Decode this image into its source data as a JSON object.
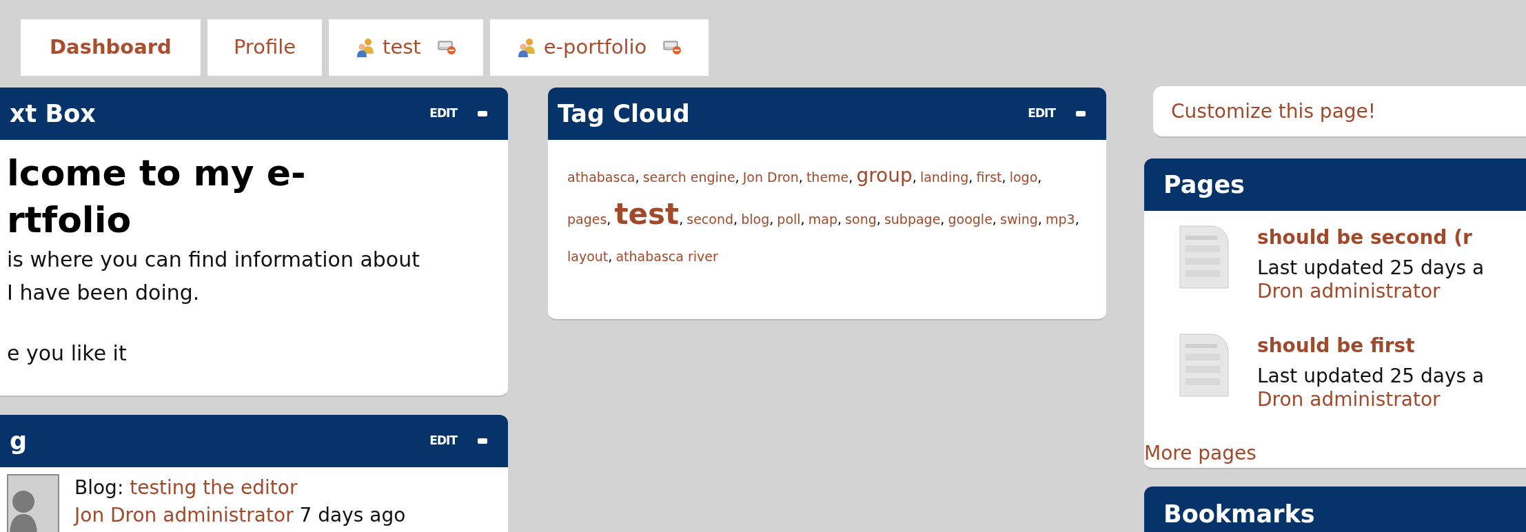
{
  "tabs": [
    {
      "label": "Dashboard",
      "selected": true,
      "kind": "page"
    },
    {
      "label": "Profile",
      "selected": false,
      "kind": "page"
    },
    {
      "label": "test",
      "selected": false,
      "kind": "group"
    },
    {
      "label": "e-portfolio",
      "selected": false,
      "kind": "group"
    }
  ],
  "text_box": {
    "title": "xt Box",
    "edit": "EDIT",
    "heading_lines": [
      "lcome to my e-",
      "rtfolio"
    ],
    "paragraph_lines": [
      "is where you can find information about",
      "I have been doing."
    ],
    "closing": "e you like it"
  },
  "blog": {
    "title": "g",
    "edit": "EDIT",
    "entry": {
      "prefix": "Blog:",
      "title": "testing the editor",
      "author": "Jon Dron administrator",
      "time": "7 days ago"
    }
  },
  "tag_cloud": {
    "title": "Tag Cloud",
    "edit": "EDIT",
    "tags": [
      {
        "label": "athabasca",
        "suffix": ",",
        "kind": "small"
      },
      {
        "label": "search engine",
        "suffix": ",",
        "kind": "small"
      },
      {
        "label": "Jon Dron",
        "suffix": ",",
        "kind": "small"
      },
      {
        "label": "theme",
        "suffix": ",",
        "kind": "small"
      },
      {
        "label": "group",
        "suffix": ",",
        "kind": "medium"
      },
      {
        "label": "landing",
        "suffix": ",",
        "kind": "small"
      },
      {
        "label": "first",
        "suffix": ",",
        "kind": "small"
      },
      {
        "label": "logo",
        "suffix": ",",
        "kind": "small"
      },
      {
        "label": "pages",
        "suffix": ",",
        "kind": "small"
      },
      {
        "label": "test",
        "suffix": ",",
        "kind": "large"
      },
      {
        "label": "second",
        "suffix": ",",
        "kind": "small"
      },
      {
        "label": "blog",
        "suffix": ",",
        "kind": "small"
      },
      {
        "label": "poll",
        "suffix": ",",
        "kind": "small"
      },
      {
        "label": "map",
        "suffix": ",",
        "kind": "small"
      },
      {
        "label": "song",
        "suffix": ",",
        "kind": "small"
      },
      {
        "label": "subpage",
        "suffix": ",",
        "kind": "small"
      },
      {
        "label": "google",
        "suffix": ",",
        "kind": "small"
      },
      {
        "label": "swing",
        "suffix": ",",
        "kind": "small"
      },
      {
        "label": "mp3",
        "suffix": ",",
        "kind": "small"
      },
      {
        "label": "layout",
        "suffix": ",",
        "kind": "small"
      },
      {
        "label": "athabasca river",
        "kind": "small"
      }
    ]
  },
  "customize": {
    "label": "Customize this page!"
  },
  "pages": {
    "title": "Pages",
    "items": [
      {
        "title": "should be second (r",
        "updated": "Last updated 25 days a",
        "author": "Dron administrator"
      },
      {
        "title": "should be first",
        "updated": "Last updated 25 days a",
        "author": "Dron administrator"
      }
    ],
    "more": "More pages"
  },
  "bookmarks": {
    "title": "Bookmarks"
  }
}
